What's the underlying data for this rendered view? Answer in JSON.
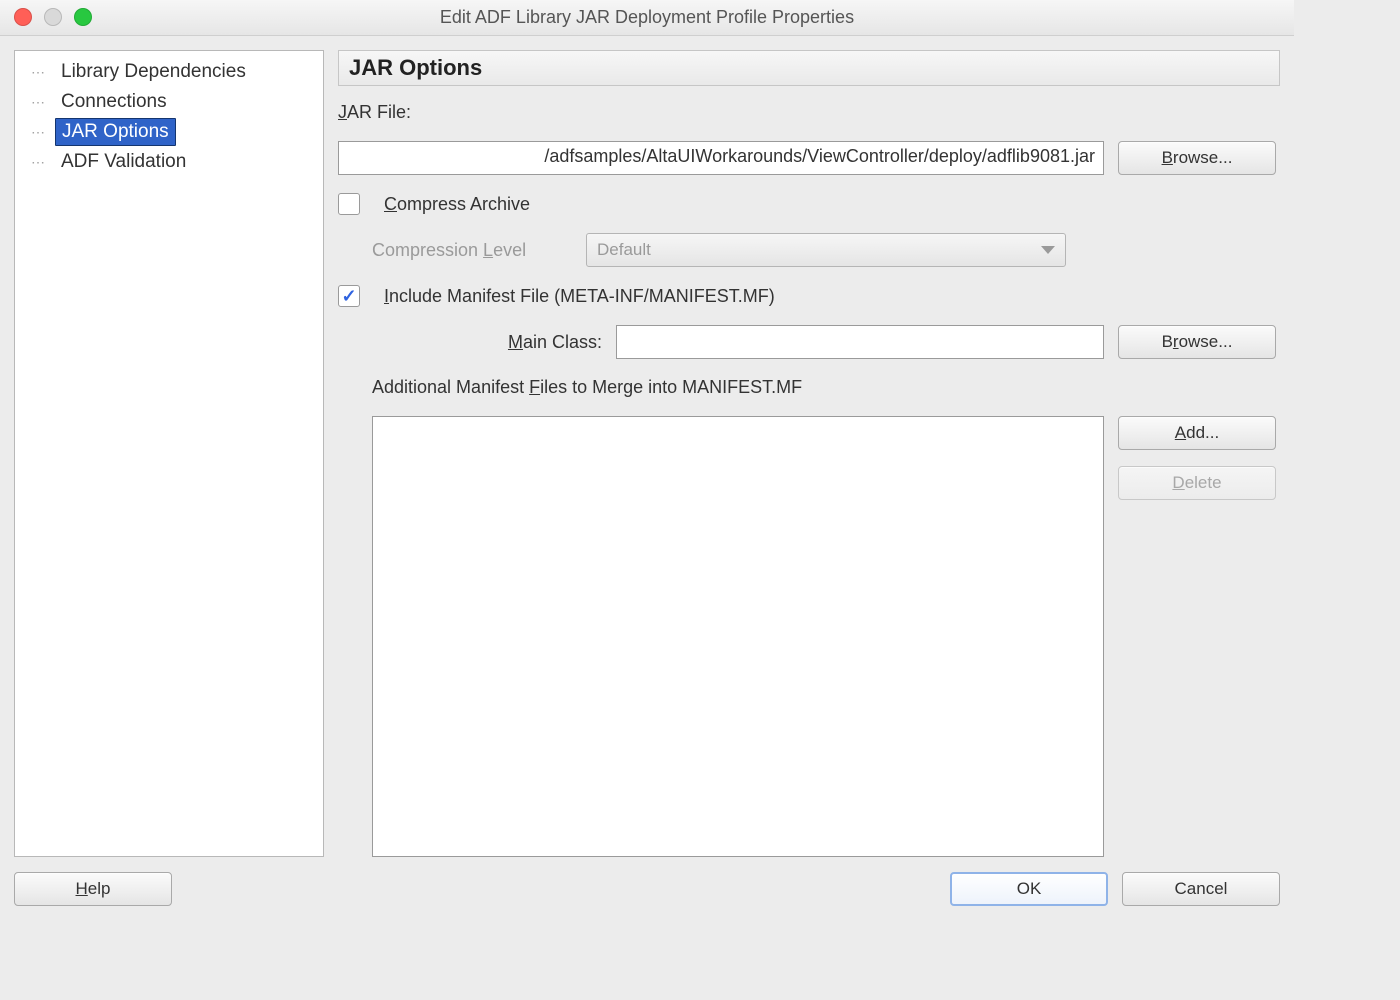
{
  "window": {
    "title": "Edit ADF Library JAR Deployment Profile Properties"
  },
  "sidebar": {
    "items": [
      {
        "label": "Library Dependencies",
        "selected": false
      },
      {
        "label": "Connections",
        "selected": false
      },
      {
        "label": "JAR Options",
        "selected": true
      },
      {
        "label": "ADF Validation",
        "selected": false
      }
    ]
  },
  "section": {
    "title": "JAR Options"
  },
  "form": {
    "jar_file_label_pre": "",
    "jar_file_label_ul": "J",
    "jar_file_label_post": "AR File:",
    "jar_file_value": "/adfsamples/AltaUIWorkarounds/ViewController/deploy/adflib9081.jar",
    "browse_label_ul": "B",
    "browse_label_post": "rowse...",
    "browse2_label_pre": "B",
    "browse2_label_ul": "r",
    "browse2_label_post": "owse...",
    "compress_checked": false,
    "compress_label_ul": "C",
    "compress_label_post": "ompress Archive",
    "compression_level_label_pre": "Compression ",
    "compression_level_label_ul": "L",
    "compression_level_label_post": "evel",
    "compression_level_value": "Default",
    "include_manifest_checked": true,
    "include_manifest_label_ul": "I",
    "include_manifest_label_post": "nclude Manifest File (META-INF/MANIFEST.MF)",
    "main_class_label_ul": "M",
    "main_class_label_post": "ain Class:",
    "main_class_value": "",
    "additional_label_pre": "Additional Manifest ",
    "additional_label_ul": "F",
    "additional_label_post": "iles to Merge into MANIFEST.MF",
    "add_label_ul": "A",
    "add_label_post": "dd...",
    "delete_label_ul": "D",
    "delete_label_post": "elete"
  },
  "footer": {
    "help_label_ul": "H",
    "help_label_post": "elp",
    "ok_label": "OK",
    "cancel_label": "Cancel"
  }
}
